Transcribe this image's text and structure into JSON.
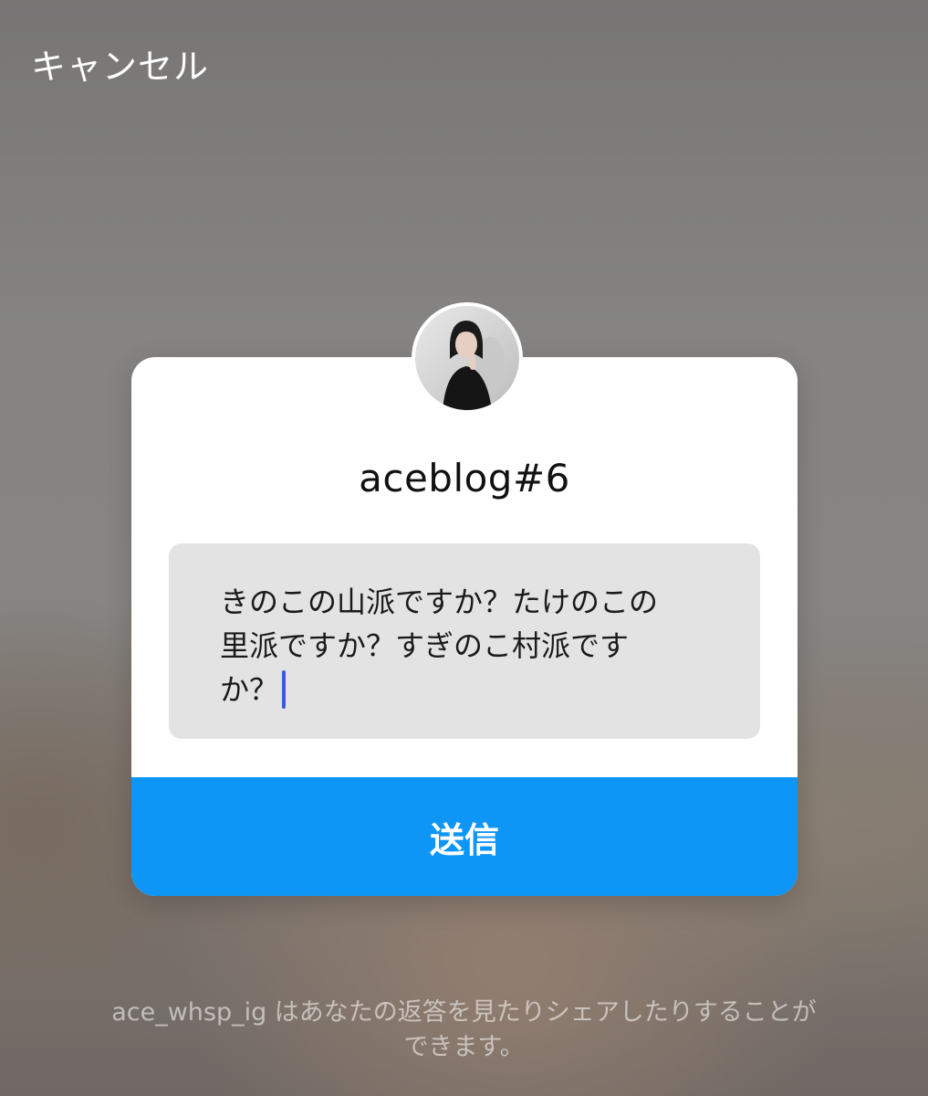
{
  "header": {
    "cancel_label": "キャンセル"
  },
  "card": {
    "avatar_icon": "profile-photo",
    "title": "aceblog#6",
    "answer_line1": "きのこの山派ですか？たけのこの",
    "answer_line2": "里派ですか？すぎのこ村派です",
    "answer_line3": "か？",
    "send_label": "送信",
    "accent_color": "#0d96f6"
  },
  "footer": {
    "line1": "ace_whsp_ig はあなたの返答を見たりシェアしたりすることが",
    "line2": "できます。"
  }
}
